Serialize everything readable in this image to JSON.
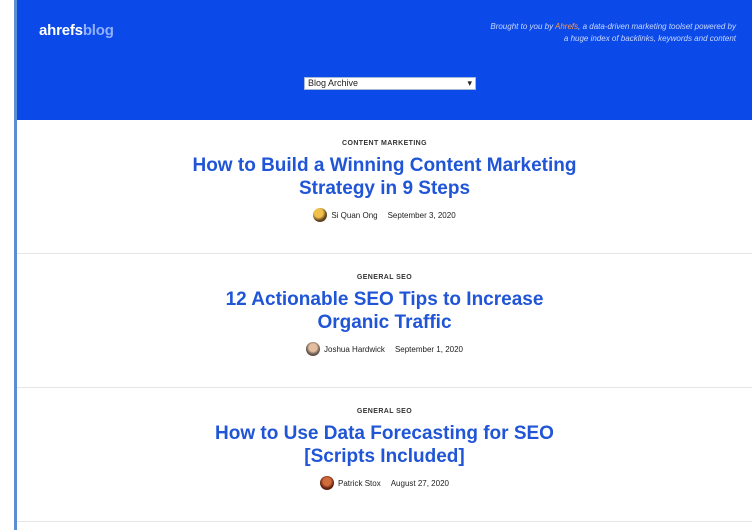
{
  "header": {
    "logo_brand": "ahrefs",
    "logo_blog": "blog",
    "tagline_pre": "Brought to you by ",
    "tagline_link": "Ahrefs",
    "tagline_post": ", a data-driven marketing toolset powered by a huge index of backlinks, keywords and content",
    "archive_select": "Blog Archive"
  },
  "posts": [
    {
      "category": "CONTENT MARKETING",
      "title": "How to Build a Winning Content Marketing Strategy in 9 Steps",
      "author": "Si Quan Ong",
      "date": "September 3, 2020"
    },
    {
      "category": "GENERAL SEO",
      "title": "12 Actionable SEO Tips to Increase Organic Traffic",
      "author": "Joshua Hardwick",
      "date": "September 1, 2020"
    },
    {
      "category": "GENERAL SEO",
      "title": "How to Use Data Forecasting for SEO [Scripts Included]",
      "author": "Patrick Stox",
      "date": "August 27, 2020"
    }
  ],
  "colors": {
    "header_bg": "#0b49e8",
    "title": "#1f55d6",
    "accent": "#ff9a45"
  }
}
